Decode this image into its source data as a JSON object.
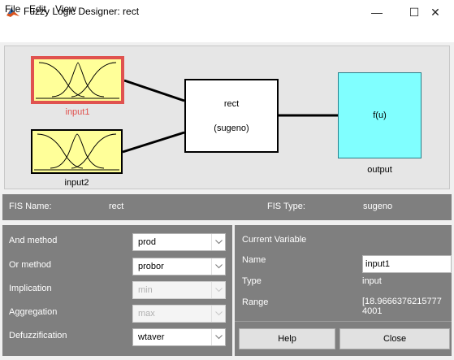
{
  "window": {
    "title": "Fuzzy Logic Designer: rect",
    "controls": {
      "minimize": "—",
      "maximize": "☐",
      "close": "✕"
    }
  },
  "menu": {
    "file": "File",
    "edit": "Edit",
    "view": "View"
  },
  "diagram": {
    "input1_label": "input1",
    "input2_label": "input2",
    "rule_name": "rect",
    "rule_type": "(sugeno)",
    "output_func": "f(u)",
    "output_label": "output"
  },
  "fis": {
    "name_label": "FIS Name:",
    "name_value": "rect",
    "type_label": "FIS Type:",
    "type_value": "sugeno"
  },
  "methods": {
    "and": {
      "label": "And method",
      "value": "prod"
    },
    "or": {
      "label": "Or method",
      "value": "probor"
    },
    "implication": {
      "label": "Implication",
      "value": "min"
    },
    "aggregation": {
      "label": "Aggregation",
      "value": "max"
    },
    "defuzz": {
      "label": "Defuzzification",
      "value": "wtaver"
    }
  },
  "current_variable": {
    "title": "Current Variable",
    "name_label": "Name",
    "name_value": "input1",
    "type_label": "Type",
    "type_value": "input",
    "range_label": "Range",
    "range_value": "[18.9666376215777 4001"
  },
  "buttons": {
    "help": "Help",
    "close": "Close"
  },
  "colors": {
    "input_box": "#ffff99",
    "selected_border": "#e0524f",
    "output_box": "#80ffff",
    "panel": "#7f7f7f"
  }
}
